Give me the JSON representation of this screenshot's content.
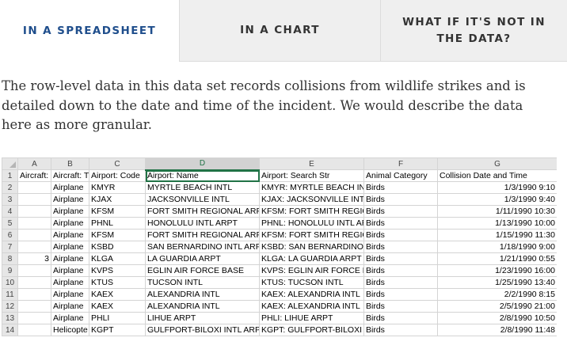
{
  "tabs": {
    "spreadsheet": "IN A SPREADSHEET",
    "chart": "IN A CHART",
    "not_in_data": "WHAT IF IT'S NOT IN THE DATA?"
  },
  "intro": "The row-level data in this data set records collisions from wildlife strikes and is detailed down to the date and time of the incident. We would describe the data here as more granular.",
  "spreadsheet": {
    "column_letters": [
      "A",
      "B",
      "C",
      "D",
      "E",
      "F",
      "G"
    ],
    "selected_column": "D",
    "header_row": [
      "Aircraft:",
      "Aircraft: T",
      "Airport: Code",
      "Airport: Name",
      "Airport: Search Str",
      "Animal Category",
      "Collision Date and Time"
    ],
    "rows": [
      [
        "",
        "Airplane",
        "KMYR",
        "MYRTLE BEACH INTL",
        "KMYR: MYRTLE BEACH INTL",
        "Birds",
        "1/3/1990 9:10"
      ],
      [
        "",
        "Airplane",
        "KJAX",
        "JACKSONVILLE INTL",
        "KJAX: JACKSONVILLE INTL",
        "Birds",
        "1/3/1990 9:40"
      ],
      [
        "",
        "Airplane",
        "KFSM",
        "FORT SMITH REGIONAL ARPT",
        "KFSM: FORT SMITH REGIONA",
        "Birds",
        "1/11/1990 10:30"
      ],
      [
        "",
        "Airplane",
        "PHNL",
        "HONOLULU INTL ARPT",
        "PHNL: HONOLULU INTL ARPT",
        "Birds",
        "1/13/1990 10:00"
      ],
      [
        "",
        "Airplane",
        "KFSM",
        "FORT SMITH REGIONAL ARPT",
        "KFSM: FORT SMITH REGIONA",
        "Birds",
        "1/15/1990 11:30"
      ],
      [
        "",
        "Airplane",
        "KSBD",
        "SAN BERNARDINO INTL ARPT",
        "KSBD: SAN BERNARDINO INT",
        "Birds",
        "1/18/1990 9:00"
      ],
      [
        "3",
        "Airplane",
        "KLGA",
        "LA GUARDIA ARPT",
        "KLGA: LA GUARDIA ARPT",
        "Birds",
        "1/21/1990 0:55"
      ],
      [
        "",
        "Airplane",
        "KVPS",
        "EGLIN AIR FORCE BASE",
        "KVPS: EGLIN AIR FORCE BASE",
        "Birds",
        "1/23/1990 16:00"
      ],
      [
        "",
        "Airplane",
        "KTUS",
        "TUCSON INTL",
        "KTUS: TUCSON INTL",
        "Birds",
        "1/25/1990 13:40"
      ],
      [
        "",
        "Airplane",
        "KAEX",
        "ALEXANDRIA INTL",
        "KAEX: ALEXANDRIA INTL",
        "Birds",
        "2/2/1990 8:15"
      ],
      [
        "",
        "Airplane",
        "KAEX",
        "ALEXANDRIA INTL",
        "KAEX: ALEXANDRIA INTL",
        "Birds",
        "2/5/1990 21:00"
      ],
      [
        "",
        "Airplane",
        "PHLI",
        "LIHUE ARPT",
        "PHLI: LIHUE ARPT",
        "Birds",
        "2/8/1990 10:50"
      ],
      [
        "",
        "Helicopte",
        "KGPT",
        "GULFPORT-BILOXI INTL ARPT",
        "KGPT: GULFPORT-BILOXI INTI",
        "Birds",
        "2/8/1990 11:48"
      ]
    ]
  }
}
